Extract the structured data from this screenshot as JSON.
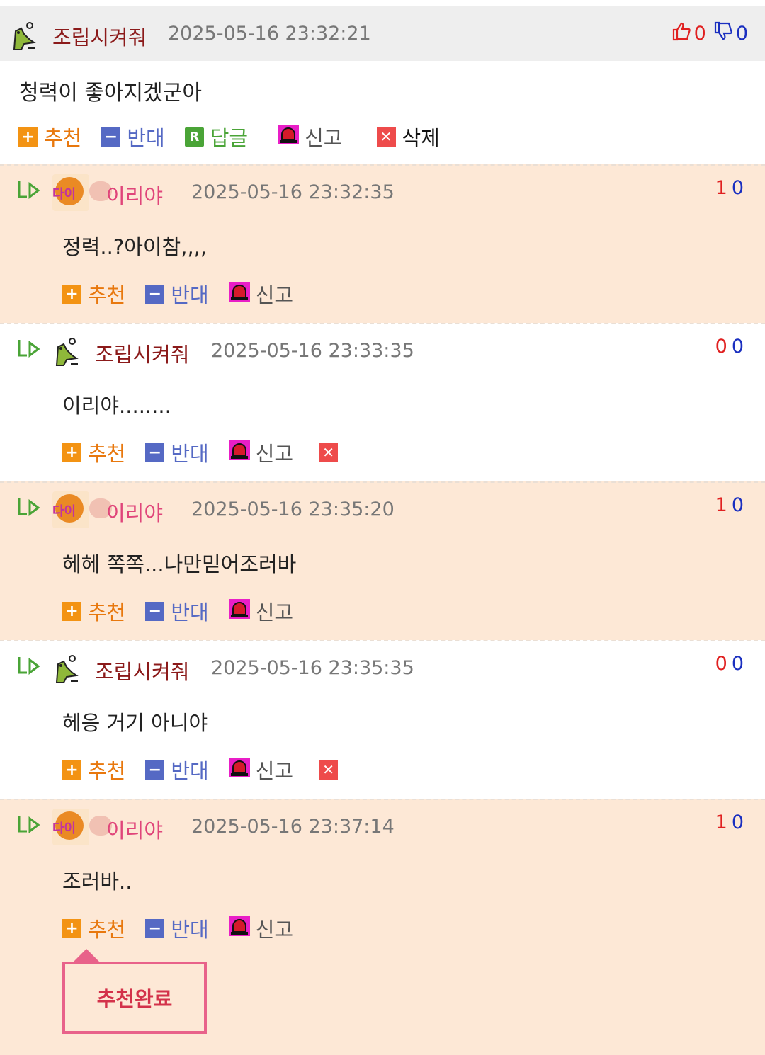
{
  "colors": {
    "accent_pink": "#e8628a",
    "peach_bg": "#fde8d6",
    "nick_dark": "#8b1a1a",
    "nick_pink": "#e0457a"
  },
  "parent": {
    "nick": "조립시켜줘",
    "date": "2025-05-16 23:32:21",
    "up": "0",
    "down": "0",
    "text": "청력이 좋아지겠군아",
    "actions": {
      "recommend": "추천",
      "oppose": "반대",
      "reply": "답글",
      "report": "신고",
      "delete": "삭제"
    },
    "icons": {
      "up": "thumbs-up-icon",
      "down": "thumbs-down-icon"
    }
  },
  "replies": [
    {
      "nick": "이리야",
      "date": "2025-05-16 23:32:35",
      "up": "1",
      "down": "0",
      "text": "정력..?아이참,,,,",
      "recommend": "추천",
      "oppose": "반대",
      "report": "신고"
    },
    {
      "nick": "조립시켜줘",
      "date": "2025-05-16 23:33:35",
      "up": "0",
      "down": "0",
      "text": "이리야........",
      "recommend": "추천",
      "oppose": "반대",
      "report": "신고"
    },
    {
      "nick": "이리야",
      "date": "2025-05-16 23:35:20",
      "up": "1",
      "down": "0",
      "text": "헤헤 쪽쪽...나만믿어조러바",
      "recommend": "추천",
      "oppose": "반대",
      "report": "신고"
    },
    {
      "nick": "조립시켜줘",
      "date": "2025-05-16 23:35:35",
      "up": "0",
      "down": "0",
      "text": "헤응 거기 아니야",
      "recommend": "추천",
      "oppose": "반대",
      "report": "신고"
    },
    {
      "nick": "이리야",
      "date": "2025-05-16 23:37:14",
      "up": "1",
      "down": "0",
      "text": "조러바..",
      "recommend": "추천",
      "oppose": "반대",
      "report": "신고"
    }
  ],
  "avatar_text": "다이",
  "popup": {
    "text": "추천완료"
  }
}
